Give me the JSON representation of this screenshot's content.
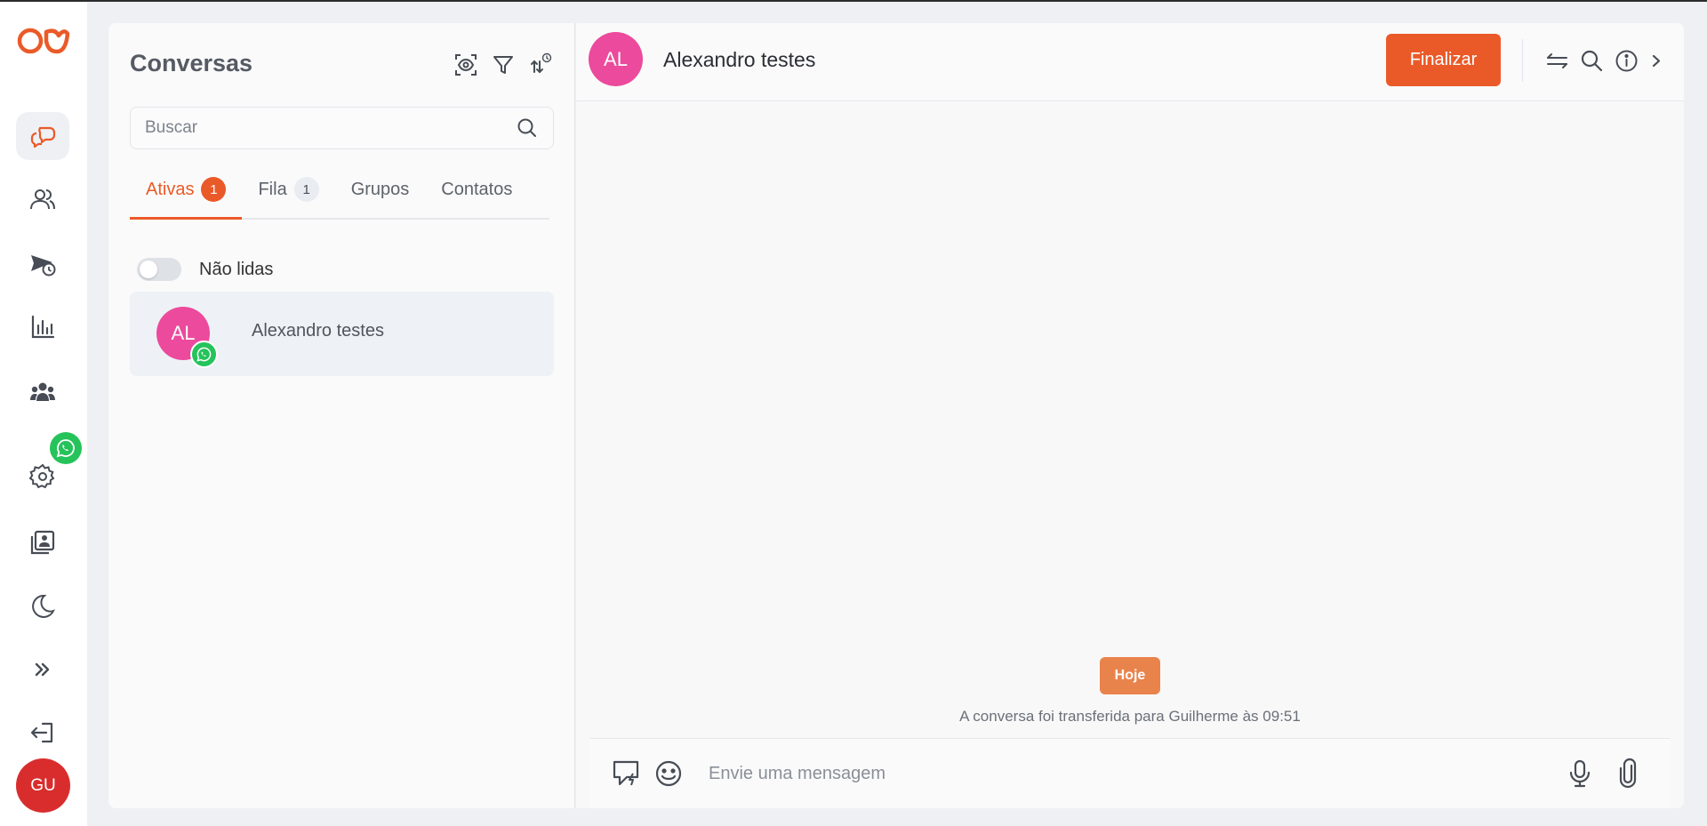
{
  "rail": {
    "items": [
      {
        "name": "conversations",
        "icon": "chat-bubbles-icon",
        "active": true
      },
      {
        "name": "contacts",
        "icon": "users-icon"
      },
      {
        "name": "scheduled-campaigns",
        "icon": "send-clock-icon"
      },
      {
        "name": "reports",
        "icon": "bar-chart-icon"
      },
      {
        "name": "teams",
        "icon": "group-icon"
      },
      {
        "name": "settings",
        "icon": "gear-icon"
      },
      {
        "name": "contact-book",
        "icon": "contact-book-icon"
      },
      {
        "name": "dark-mode",
        "icon": "moon-icon"
      },
      {
        "name": "expand",
        "icon": "double-chevron-right-icon"
      },
      {
        "name": "logout",
        "icon": "logout-icon"
      }
    ],
    "user_initials": "GU"
  },
  "conversations": {
    "title": "Conversas",
    "search_placeholder": "Buscar",
    "tabs": [
      {
        "label": "Ativas",
        "badge": "1",
        "active": true
      },
      {
        "label": "Fila",
        "badge": "1"
      },
      {
        "label": "Grupos"
      },
      {
        "label": "Contatos"
      }
    ],
    "unread_toggle_label": "Não lidas",
    "items": [
      {
        "initials": "AL",
        "name": "Alexandro testes",
        "channel": "whatsapp-icon"
      }
    ]
  },
  "chat": {
    "contact_initials": "AL",
    "contact_name": "Alexandro testes",
    "finalize_label": "Finalizar",
    "date_chip": "Hoje",
    "system_message": "A conversa foi transferida para Guilherme às 09:51",
    "composer_placeholder": "Envie uma mensagem"
  },
  "colors": {
    "accent": "#ea5a28",
    "avatar_pink": "#ec4a9c",
    "whatsapp_green": "#25c35a",
    "user_avatar_red": "#d92d2d",
    "date_chip": "#e9834c"
  }
}
